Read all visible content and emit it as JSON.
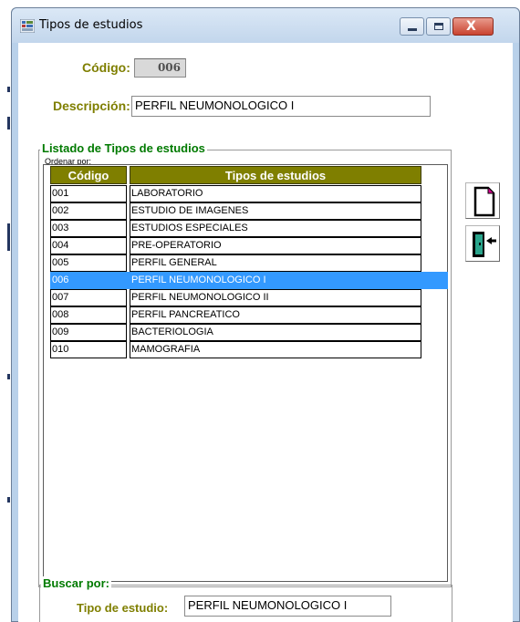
{
  "window": {
    "title": "Tipos de estudios",
    "close_glyph": "X",
    "accent_color": "#7f7f00",
    "group_title_color": "#007a00",
    "selection_color": "#3399ff"
  },
  "form": {
    "codigo_label": "Código:",
    "codigo_value": "006",
    "descripcion_label": "Descripción:",
    "descripcion_value": "PERFIL NEUMONOLOGICO I"
  },
  "listado": {
    "group_title": "Listado de Tipos de estudios",
    "ordenar_label": "Ordenar por:",
    "columns": [
      "Código",
      "Tipos de estudios"
    ],
    "rows": [
      {
        "code": "001",
        "name": "LABORATORIO"
      },
      {
        "code": "002",
        "name": "ESTUDIO DE IMAGENES"
      },
      {
        "code": "003",
        "name": "ESTUDIOS ESPECIALES"
      },
      {
        "code": "004",
        "name": "PRE-OPERATORIO"
      },
      {
        "code": "005",
        "name": "PERFIL GENERAL"
      },
      {
        "code": "006",
        "name": "PERFIL NEUMONOLOGICO I"
      },
      {
        "code": "007",
        "name": "PERFIL NEUMONOLOGICO II"
      },
      {
        "code": "008",
        "name": "PERFIL PANCREATICO"
      },
      {
        "code": "009",
        "name": "BACTERIOLOGIA"
      },
      {
        "code": "010",
        "name": "MAMOGRAFIA"
      }
    ],
    "selected_code": "006"
  },
  "side_buttons": [
    {
      "icon": "new-document-icon"
    },
    {
      "icon": "exit-door-icon"
    }
  ],
  "buscar": {
    "group_title": "Buscar por:",
    "tipo_label": "Tipo de estudio:",
    "tipo_value": "PERFIL NEUMONOLOGICO I"
  }
}
